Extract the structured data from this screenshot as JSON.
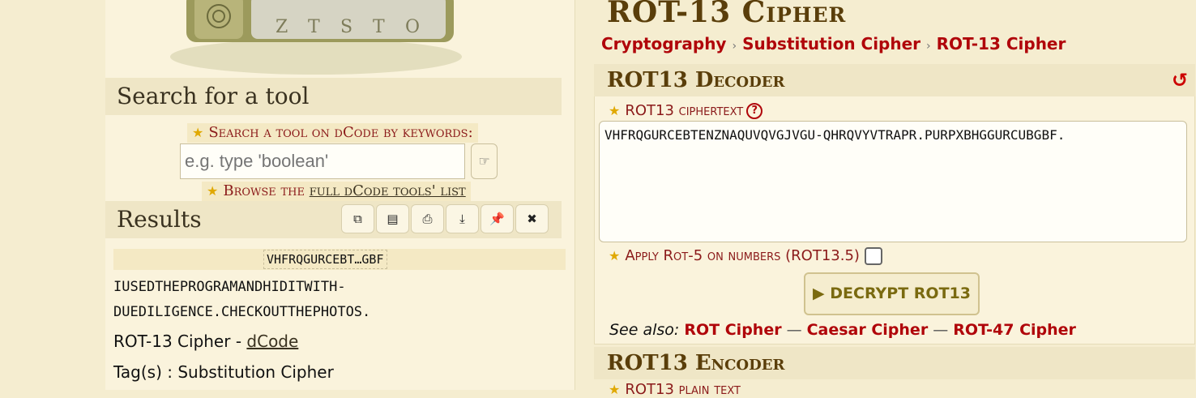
{
  "sidebar": {
    "search_heading": "Search for a tool",
    "search_label": "Search a tool on dCode by keywords:",
    "search_placeholder": "e.g. type 'boolean'",
    "browse_prefix": "Browse the ",
    "browse_link": "full dCode tools' list",
    "results_heading": "Results",
    "tool_icons": [
      "copy-icon",
      "note-icon",
      "print-icon",
      "download-icon",
      "pin-icon",
      "close-icon"
    ],
    "result_tag": "VHFRQGURCEBT…GBF",
    "result_line1": "IUSEDTHEPROGRAMANDHIDITWITH-",
    "result_line2": "DUEDILIGENCE.CHECKOUTTHEPHOTOS.",
    "credit_prefix": "ROT-13 Cipher - ",
    "credit_link": "dCode",
    "tags": "Tag(s) : Substitution Cipher"
  },
  "main": {
    "title": "ROT-13 Cipher",
    "breadcrumb": [
      "Cryptography",
      "Substitution Cipher",
      "ROT-13 Cipher"
    ],
    "decoder_heading": "ROT13 Decoder",
    "ciphertext_label": "ROT13 ciphertext",
    "ciphertext_value": "VHFRQGURCEBTENZNAQUVQVGJVGU-QHRQVYVTRAPR.PURPXBHGGURCUBGBF.",
    "rot5_label": "Apply Rot-5 on numbers (ROT13.5)",
    "decrypt_button": "DECRYPT ROT13",
    "see_also_label": "See also:",
    "see_also_links": [
      "ROT Cipher",
      "Caesar Cipher",
      "ROT-47 Cipher"
    ],
    "encoder_heading": "ROT13 Encoder",
    "encoder_field_label": "ROT13 plain text"
  },
  "colors": {
    "accent_red": "#b0050a",
    "title_brown": "#5a3e0a",
    "panel_bg": "#faf3dc"
  }
}
